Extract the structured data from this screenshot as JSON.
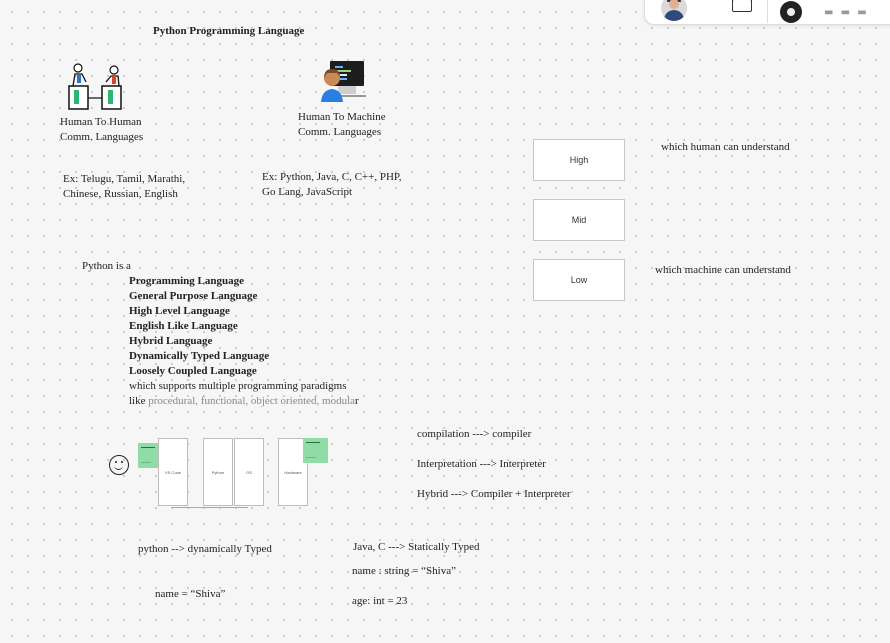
{
  "page": {
    "title": "Python Programming Language"
  },
  "human_to_human": {
    "line1": "Human To Human",
    "line2": "Comm. Languages",
    "examples_line1": "Ex: Telugu, Tamil, Marathi,",
    "examples_line2": "Chinese, Russian, English"
  },
  "human_to_machine": {
    "line1": "Human To Machine",
    "line2": "Comm. Languages",
    "examples_line1": "Ex: Python, Java, C, C++, PHP,",
    "examples_line2": "Go Lang, JavaScript"
  },
  "python_is": {
    "intro": "Python is a",
    "features": [
      "Programming Language",
      "General Purpose Language",
      "High Level Language",
      "English Like Language",
      "Hybrid Language",
      "Dynamically Typed Language",
      "Loosely Coupled Language"
    ],
    "paradigm_line1": "which  supports multiple programming paradigms",
    "paradigm_prefix": "like ",
    "paradigm_list": "procedural, functional, object oriented, modula",
    "paradigm_suffix": "r"
  },
  "levels": {
    "boxes": [
      "High",
      "Mid",
      "Low"
    ],
    "high_note": "which human can understand",
    "low_note": "which machine can understand"
  },
  "translators": {
    "compilation": "compilation  ---> compiler",
    "interpretation": "Interpretation ---> Interpreter",
    "hybrid": "Hybrid ---> Compiler + Interpreter"
  },
  "cards": {
    "labels": [
      "VS Code",
      "Python",
      "OS",
      "Hardware"
    ]
  },
  "typing": {
    "python_dynamic": "python --> dynamically Typed",
    "python_example": "name = “Shiva”",
    "java_static": "Java, C ---> Statically Typed",
    "java_example1": "name : string = “Shiva”",
    "java_example2": "age: int = 23"
  },
  "toolbar": {
    "icons": [
      "user-avatar",
      "present-icon",
      "collaborator-avatar"
    ]
  }
}
